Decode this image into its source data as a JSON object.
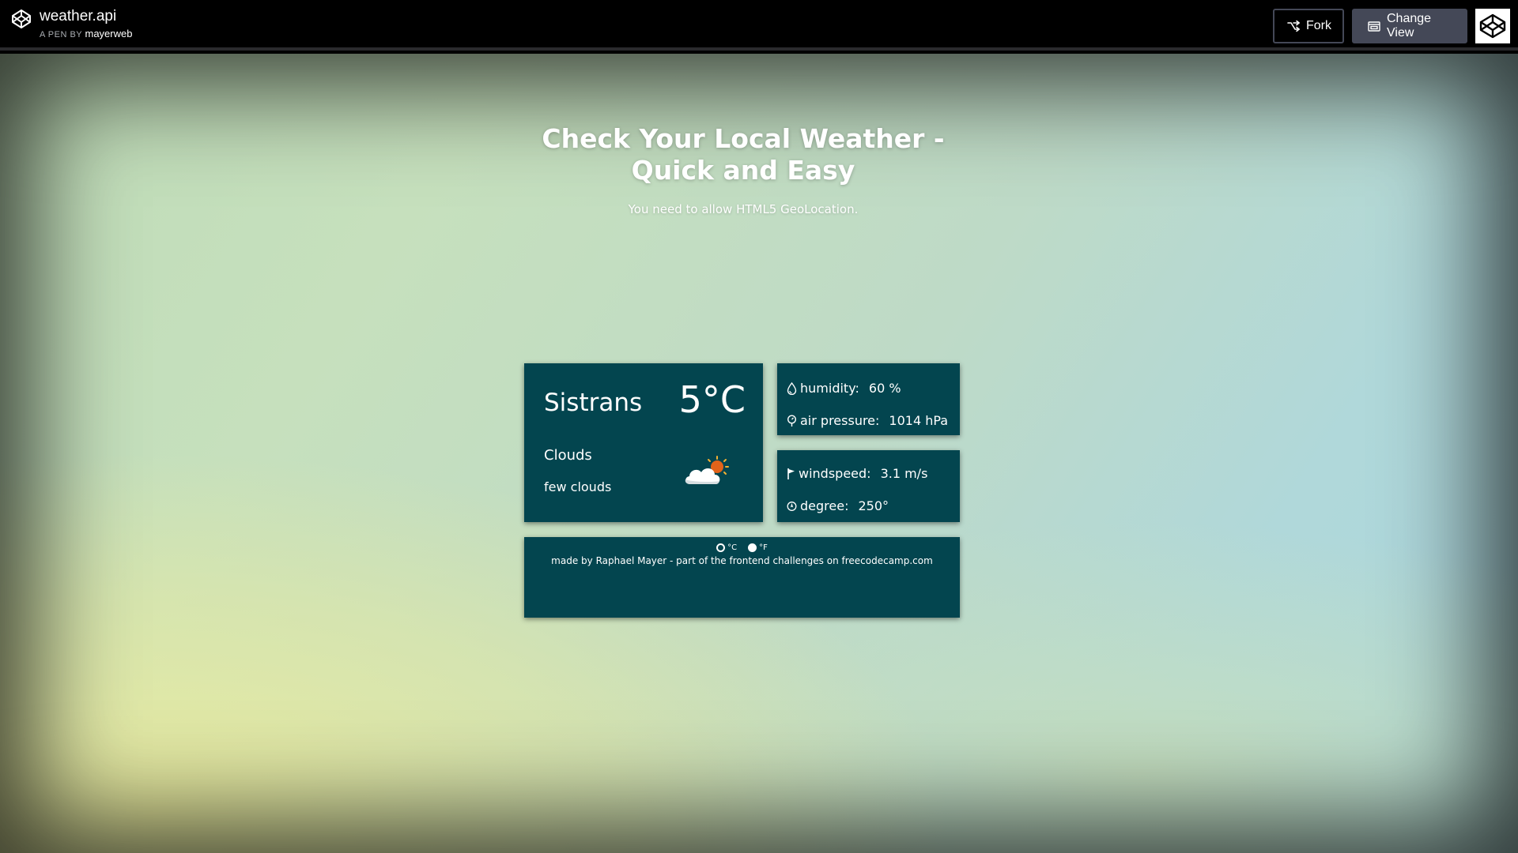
{
  "header": {
    "pen_title": "weather.api",
    "pen_by_prefix": "A PEN BY",
    "author": "mayerweb",
    "fork_label": "Fork",
    "change_view_label": "Change View"
  },
  "page": {
    "title": "Check Your Local Weather - Quick and Easy",
    "subtitle": "You need to allow HTML5 GeoLocation."
  },
  "weather": {
    "city": "Sistrans",
    "temperature": "5°C",
    "condition": "Clouds",
    "description": "few clouds",
    "icon": "cloud-sun-icon"
  },
  "stats": {
    "humidity_label": "humidity:",
    "humidity_value": "60 %",
    "pressure_label": "air pressure:",
    "pressure_value": "1014 hPa",
    "windspeed_label": "windspeed:",
    "windspeed_value": "3.1 m/s",
    "degree_label": "degree:",
    "degree_value": "250°"
  },
  "units": {
    "celsius_label": "°C",
    "fahrenheit_label": "°F",
    "selected": "°F"
  },
  "footer": {
    "credit": "made by Raphael Mayer - part of the frontend challenges on freecodecamp.com"
  },
  "colors": {
    "card_bg": "#03454f",
    "header_bg": "#000000",
    "button_bg": "#444857"
  }
}
